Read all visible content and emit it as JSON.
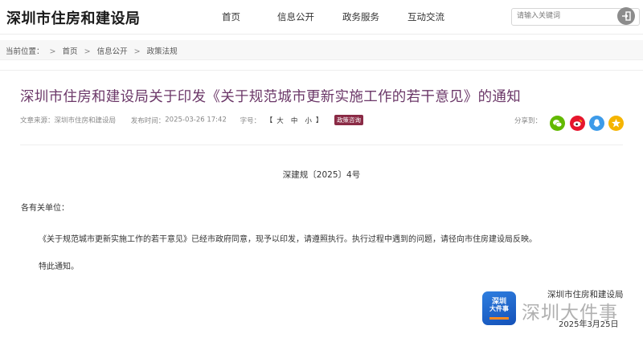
{
  "header": {
    "site_title": "深圳市住房和建设局",
    "nav": [
      "首页",
      "信息公开",
      "政务服务",
      "互动交流"
    ],
    "search_placeholder": "请输入关键词"
  },
  "breadcrumb": {
    "label": "当前位置：",
    "items": [
      "首页",
      "信息公开",
      "政策法规"
    ],
    "separator": ">"
  },
  "article": {
    "title": "深圳市住房和建设局关于印发《关于规范城市更新实施工作的若干意见》的通知",
    "source_label": "文章来源：",
    "source": "深圳市住房和建设局",
    "publish_label": "发布时间：",
    "publish_time": "2025-03-26 17:42",
    "font_label": "字号：",
    "font_bracket_open": "【",
    "font_sizes": [
      "大",
      "中",
      "小"
    ],
    "font_bracket_close": "】",
    "tag": "政策咨询",
    "share_label": "分享到：",
    "doc_number": "深建规〔2025〕4号",
    "salutation": "各有关单位：",
    "body": "《关于规范城市更新实施工作的若干意见》已经市政府同意，现予以印发，请遵照执行。执行过程中遇到的问题，请径向市住房建设局反映。",
    "closing": "特此通知。",
    "signature_org": "深圳市住房和建设局",
    "signature_date": "2025年3月25日"
  },
  "watermark": {
    "logo_line1": "深圳",
    "logo_line2": "大件事",
    "text": "深圳大件事"
  },
  "colors": {
    "title": "#6b3768",
    "tag_bg": "#8a2a45",
    "wechat": "#62b900",
    "weibo": "#e6162d",
    "qq": "#3d9be9",
    "qzone": "#f5b400"
  },
  "share_icons": [
    "wechat-icon",
    "weibo-icon",
    "qq-icon",
    "qzone-icon"
  ]
}
